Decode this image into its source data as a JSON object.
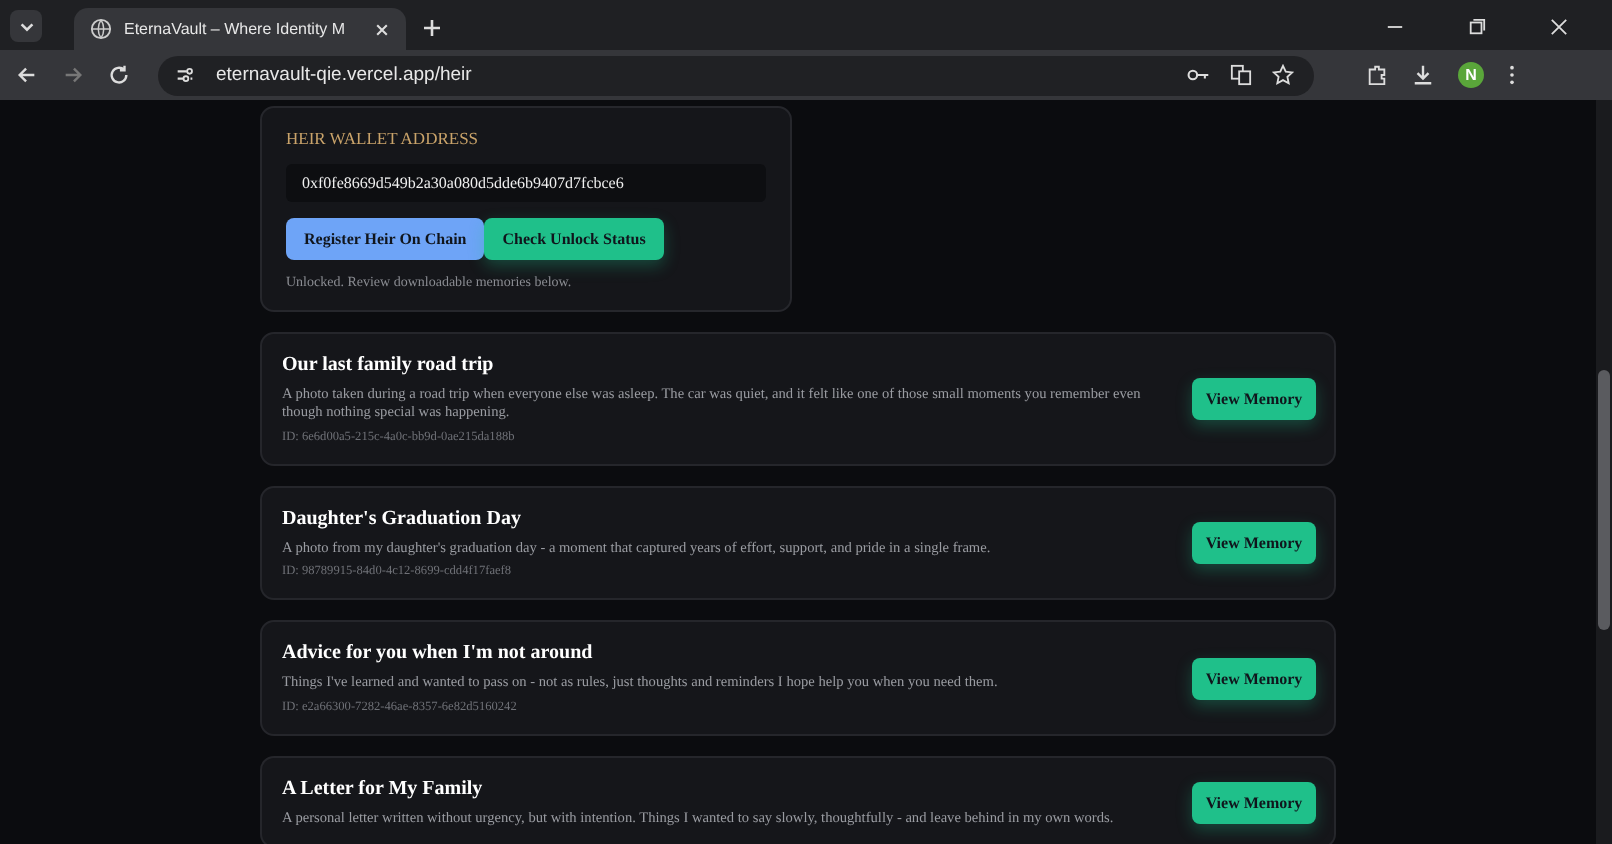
{
  "browser": {
    "tab_title": "EternaVault – Where Identity M",
    "url": "eternavault-qie.vercel.app/heir",
    "profile_initial": "N"
  },
  "wallet": {
    "label": "HEIR WALLET ADDRESS",
    "value": "0xf0fe8669d549b2a30a080d5dde6b9407d7fcbce6",
    "buttons": [
      {
        "label": "Register Heir On Chain",
        "kind": "primary"
      },
      {
        "label": "Check Unlock Status",
        "kind": "success"
      }
    ],
    "status": "Unlocked. Review downloadable memories below."
  },
  "memories": [
    {
      "title": "Our last family road trip",
      "description": "A photo taken during a road trip when everyone else was asleep. The car was quiet, and it felt like one of those small moments you remember even though nothing special was happening.",
      "id": "ID: 6e6d00a5-215c-4a0c-bb9d-0ae215da188b",
      "button": "View Memory"
    },
    {
      "title": "Daughter's Graduation Day",
      "description": "A photo from my daughter's graduation day - a moment that captured years of effort, support, and pride in a single frame.",
      "id": "ID: 98789915-84d0-4c12-8699-cdd4f17faef8",
      "button": "View Memory"
    },
    {
      "title": "Advice for you when I'm not around",
      "description": "Things I've learned and wanted to pass on - not as rules, just thoughts and reminders I hope help you when you need them.",
      "id": "ID: e2a66300-7282-46ae-8357-6e82d5160242",
      "button": "View Memory"
    },
    {
      "title": "A Letter for My Family",
      "description": "A personal letter written without urgency, but with intention. Things I wanted to say slowly, thoughtfully - and leave behind in my own words.",
      "button": "View Memory"
    }
  ]
}
